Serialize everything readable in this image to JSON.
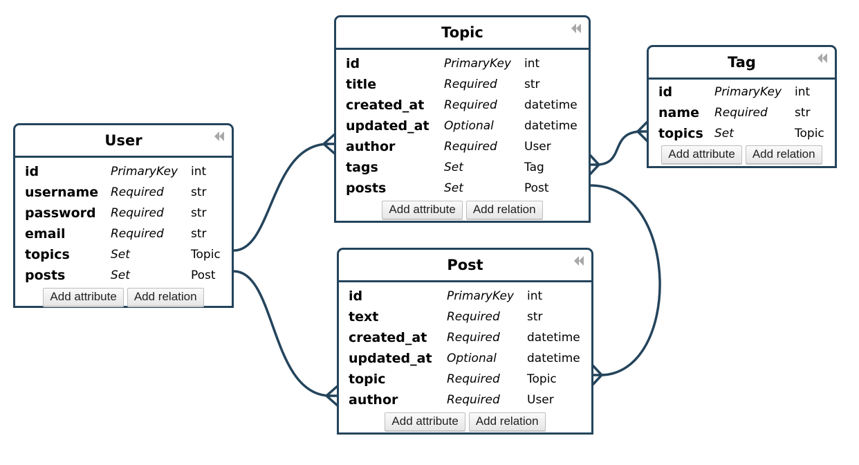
{
  "diagram": {
    "accent_color": "#24445c",
    "entities": {
      "user": {
        "title": "User",
        "attributes": [
          {
            "name": "id",
            "kind": "PrimaryKey",
            "type": "int"
          },
          {
            "name": "username",
            "kind": "Required",
            "type": "str"
          },
          {
            "name": "password",
            "kind": "Required",
            "type": "str"
          },
          {
            "name": "email",
            "kind": "Required",
            "type": "str"
          },
          {
            "name": "topics",
            "kind": "Set",
            "type": "Topic"
          },
          {
            "name": "posts",
            "kind": "Set",
            "type": "Post"
          }
        ],
        "add_attribute_label": "Add attribute",
        "add_relation_label": "Add relation"
      },
      "topic": {
        "title": "Topic",
        "attributes": [
          {
            "name": "id",
            "kind": "PrimaryKey",
            "type": "int"
          },
          {
            "name": "title",
            "kind": "Required",
            "type": "str"
          },
          {
            "name": "created_at",
            "kind": "Required",
            "type": "datetime"
          },
          {
            "name": "updated_at",
            "kind": "Optional",
            "type": "datetime"
          },
          {
            "name": "author",
            "kind": "Required",
            "type": "User"
          },
          {
            "name": "tags",
            "kind": "Set",
            "type": "Tag"
          },
          {
            "name": "posts",
            "kind": "Set",
            "type": "Post"
          }
        ],
        "add_attribute_label": "Add attribute",
        "add_relation_label": "Add relation"
      },
      "tag": {
        "title": "Tag",
        "attributes": [
          {
            "name": "id",
            "kind": "PrimaryKey",
            "type": "int"
          },
          {
            "name": "name",
            "kind": "Required",
            "type": "str"
          },
          {
            "name": "topics",
            "kind": "Set",
            "type": "Topic"
          }
        ],
        "add_attribute_label": "Add attribute",
        "add_relation_label": "Add relation"
      },
      "post": {
        "title": "Post",
        "attributes": [
          {
            "name": "id",
            "kind": "PrimaryKey",
            "type": "int"
          },
          {
            "name": "text",
            "kind": "Required",
            "type": "str"
          },
          {
            "name": "created_at",
            "kind": "Required",
            "type": "datetime"
          },
          {
            "name": "updated_at",
            "kind": "Optional",
            "type": "datetime"
          },
          {
            "name": "topic",
            "kind": "Required",
            "type": "Topic"
          },
          {
            "name": "author",
            "kind": "Required",
            "type": "User"
          }
        ],
        "add_attribute_label": "Add attribute",
        "add_relation_label": "Add relation"
      }
    },
    "relations": [
      {
        "from": "User.topics",
        "to": "Topic.author",
        "cardinality": "one-to-many"
      },
      {
        "from": "User.posts",
        "to": "Post.author",
        "cardinality": "one-to-many"
      },
      {
        "from": "Topic.tags",
        "to": "Tag.topics",
        "cardinality": "many-to-many"
      },
      {
        "from": "Topic.posts",
        "to": "Post.topic",
        "cardinality": "one-to-many"
      }
    ]
  }
}
